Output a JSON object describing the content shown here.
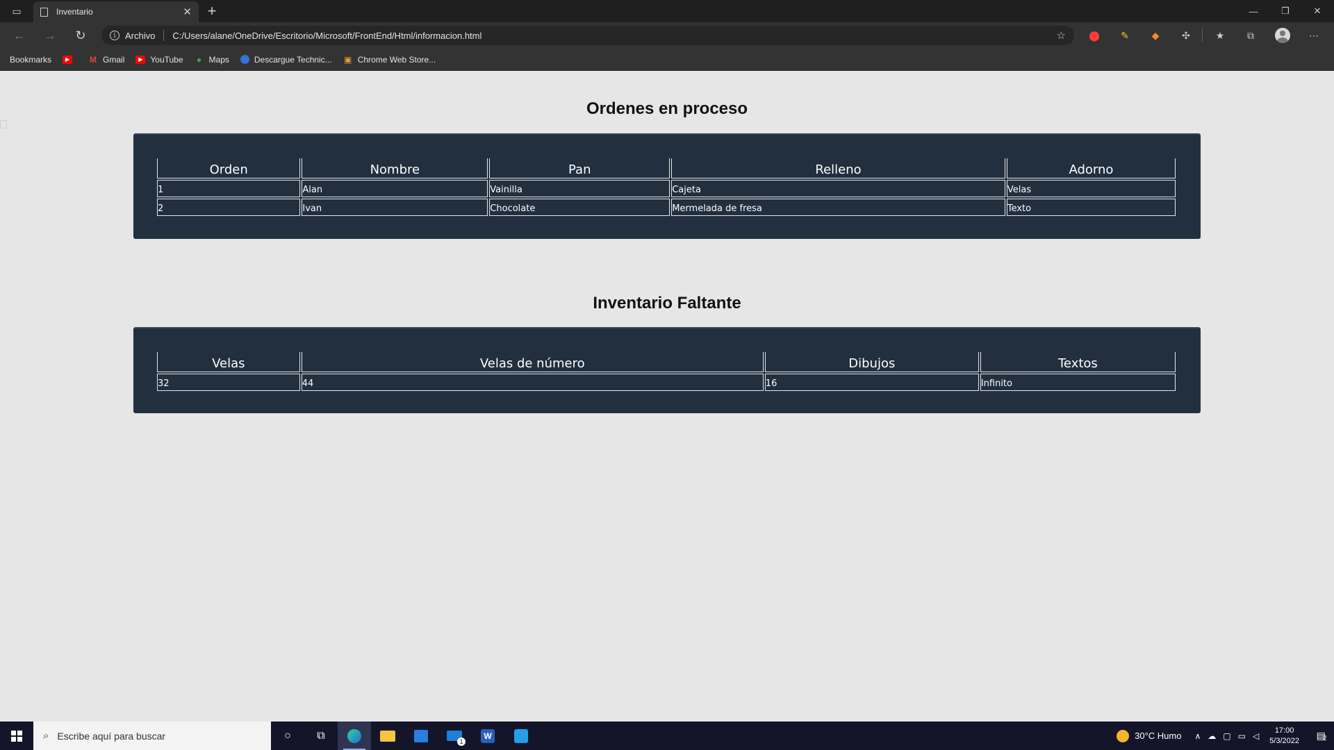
{
  "browser": {
    "tab_title": "Inventario",
    "tab_close": "✕",
    "new_tab": "+",
    "window_controls": [
      "—",
      "❐",
      "✕"
    ],
    "omnibox_label": "Archivo",
    "omnibox_url": "C:/Users/alane/OneDrive/Escritorio/Microsoft/FrontEnd/Html/informacion.html",
    "bookmarks": [
      "Bookmarks",
      "Gmail",
      "YouTube",
      "Maps",
      "Descargue Technic...",
      "Chrome Web Store..."
    ]
  },
  "orders": {
    "title": "Ordenes en proceso",
    "headers": [
      "Orden",
      "Nombre",
      "Pan",
      "Relleno",
      "Adorno"
    ],
    "rows": [
      [
        "1",
        "Alan",
        "Vainilla",
        "Cajeta",
        "Velas"
      ],
      [
        "2",
        "Ivan",
        "Chocolate",
        "Mermelada de fresa",
        "Texto"
      ]
    ]
  },
  "inventory": {
    "title": "Inventario Faltante",
    "headers": [
      "Velas",
      "Velas de número",
      "Dibujos",
      "Textos"
    ],
    "rows": [
      [
        "32",
        "44",
        "16",
        "Infinito"
      ]
    ]
  },
  "taskbar": {
    "search_placeholder": "Escribe aquí para buscar",
    "weather": "30°C  Humo",
    "time": "17:00",
    "date": "5/3/2022",
    "notifications": "2",
    "mail_badge": "1"
  },
  "colors": {
    "panel": "#212f3f",
    "page_bg": "#e6e6e6"
  }
}
